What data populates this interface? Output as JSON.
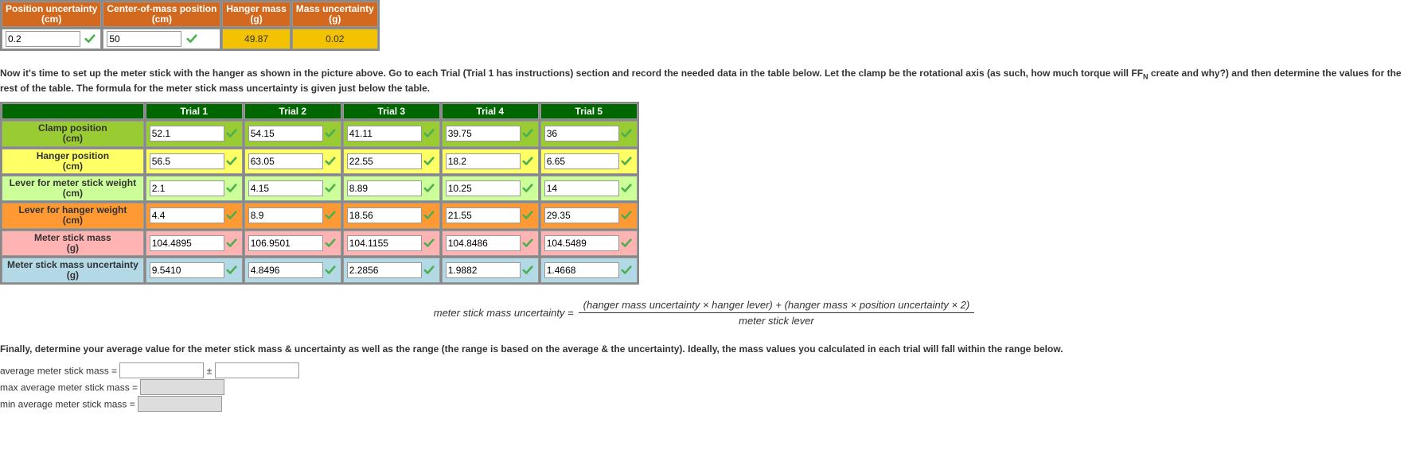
{
  "topTable": {
    "headers": [
      "Position uncertainty\n(cm)",
      "Center-of-mass position\n(cm)",
      "Hanger mass\n(g)",
      "Mass uncertainty\n(g)"
    ],
    "pos_unc": "0.2",
    "com_pos": "50",
    "hanger_mass": "49.87",
    "mass_unc": "0.02"
  },
  "instructions1_a": "Now it's time to set up the meter stick with the hanger as shown in the picture above. Go to each Trial (Trial 1 has instructions) section and record the needed data in the table below. Let the clamp be the rotational axis (as such, how much torque will F",
  "instructions1_sub": "N",
  "instructions1_b": " create and why?) and then determine the values for the rest of the table. The formula for the meter stick mass uncertainty is given just below the table.",
  "trials": {
    "headers": [
      "Trial 1",
      "Trial 2",
      "Trial 3",
      "Trial 4",
      "Trial 5"
    ],
    "rows": [
      {
        "label": "Clamp position\n(cm)",
        "cls": "bg-limegreen",
        "rowcls": "row-limegreen",
        "vals": [
          "52.1",
          "54.15",
          "41.11",
          "39.75",
          "36"
        ]
      },
      {
        "label": "Hanger position\n(cm)",
        "cls": "bg-yellow",
        "rowcls": "row-yellow",
        "vals": [
          "56.5",
          "63.05",
          "22.55",
          "18.2",
          "6.65"
        ]
      },
      {
        "label": "Lever for meter stick weight\n(cm)",
        "cls": "bg-lightgreen",
        "rowcls": "row-lightgreen",
        "vals": [
          "2.1",
          "4.15",
          "8.89",
          "10.25",
          "14"
        ]
      },
      {
        "label": "Lever for hanger weight\n(cm)",
        "cls": "bg-orange",
        "rowcls": "row-orange",
        "vals": [
          "4.4",
          "8.9",
          "18.56",
          "21.55",
          "29.35"
        ]
      },
      {
        "label": "Meter stick mass\n(g)",
        "cls": "bg-pink",
        "rowcls": "row-pink",
        "vals": [
          "104.4895",
          "106.9501",
          "104.1155",
          "104.8486",
          "104.5489"
        ]
      },
      {
        "label": "Meter stick mass uncertainty\n(g)",
        "cls": "bg-lightblue",
        "rowcls": "row-lightblue",
        "vals": [
          "9.5410",
          "4.8496",
          "2.2856",
          "1.9882",
          "1.4668"
        ]
      }
    ]
  },
  "formula": {
    "lhs": "meter stick mass uncertainty = ",
    "num": "(hanger mass uncertainty × hanger lever) + (hanger mass × position uncertainty × 2)",
    "den": "meter stick lever"
  },
  "instructions2": "Finally, determine your average value for the meter stick mass & uncertainty as well as the range (the range is based on the average & the uncertainty). Ideally, the mass values you calculated in each trial will fall within the range below.",
  "final": {
    "avg_label": "average meter stick mass = ",
    "pm": " ± ",
    "max_label": "max average meter stick mass = ",
    "min_label": "min average meter stick mass = ",
    "avg_val": "",
    "avg_unc": "",
    "max_val": "",
    "min_val": ""
  }
}
